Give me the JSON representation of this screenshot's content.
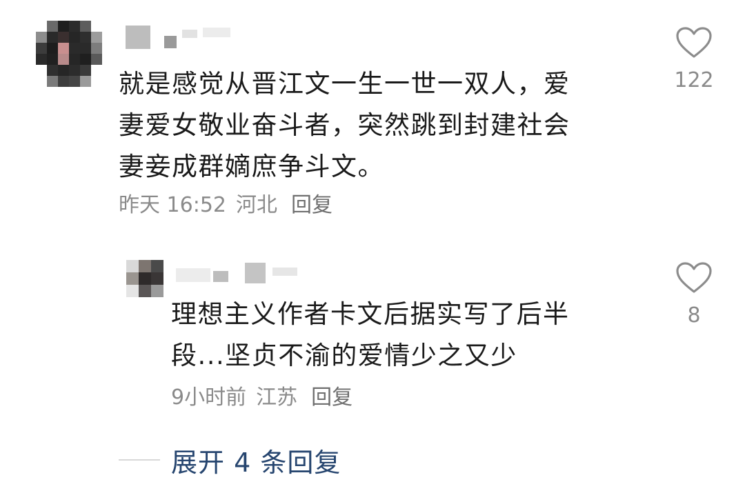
{
  "comment": {
    "avatar_icon": "pixelated-avatar",
    "lines": [
      "就是感觉从晋江文一生一世一双人，爱",
      "妻爱女敬业奋斗者，突然跳到封建社会",
      "妻妾成群嫡庶争斗文。"
    ],
    "time": "昨天 16:52",
    "location": "河北",
    "reply_label": "回复",
    "like_icon": "heart-outline-icon",
    "like_count": "122"
  },
  "reply": {
    "avatar_icon": "pixelated-avatar",
    "lines": [
      "理想主义作者卡文后据实写了后半",
      "段...坚贞不渝的爱情少之又少"
    ],
    "time": "9小时前",
    "location": "江苏",
    "reply_label": "回复",
    "like_icon": "heart-outline-icon",
    "like_count": "8"
  },
  "expand": {
    "label": "展开 4 条回复"
  },
  "colors": {
    "text": "#1a1a1a",
    "meta": "#8a8a8a",
    "link": "#26456f",
    "divider": "#d8d8d8"
  }
}
